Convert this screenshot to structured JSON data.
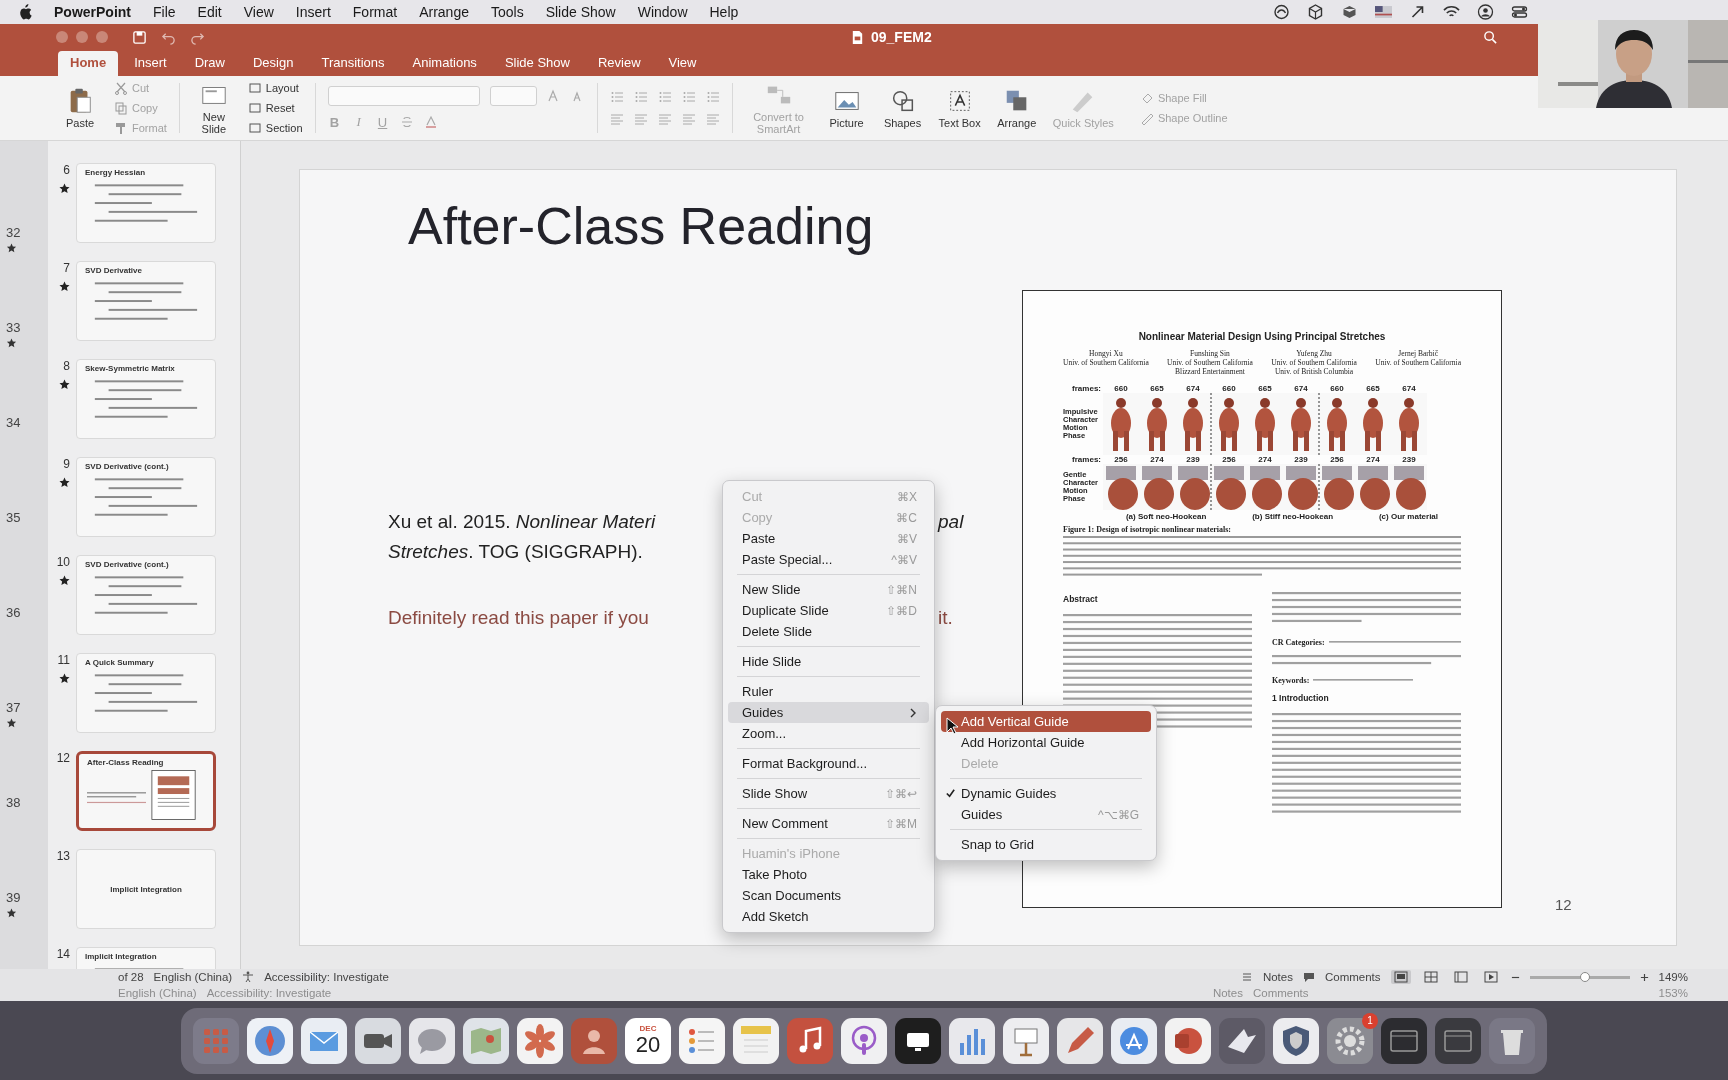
{
  "menu_bar": {
    "app": "PowerPoint",
    "items": [
      "File",
      "Edit",
      "View",
      "Insert",
      "Format",
      "Arrange",
      "Tools",
      "Slide Show",
      "Window",
      "Help"
    ]
  },
  "window": {
    "title": "09_FEM2"
  },
  "tabs": [
    {
      "label": "Home",
      "selected": true
    },
    {
      "label": "Insert",
      "selected": false
    },
    {
      "label": "Draw",
      "selected": false
    },
    {
      "label": "Design",
      "selected": false
    },
    {
      "label": "Transitions",
      "selected": false
    },
    {
      "label": "Animations",
      "selected": false
    },
    {
      "label": "Slide Show",
      "selected": false
    },
    {
      "label": "Review",
      "selected": false
    },
    {
      "label": "View",
      "selected": false
    }
  ],
  "ribbon": {
    "paste": {
      "label": "Paste",
      "disabled": false
    },
    "clipboard": [
      {
        "label": "Cut",
        "disabled": true
      },
      {
        "label": "Copy",
        "disabled": true
      },
      {
        "label": "Format",
        "disabled": true
      }
    ],
    "new_slide": {
      "label": "New Slide",
      "disabled": false
    },
    "slide_tools": [
      {
        "label": "Layout",
        "disabled": false
      },
      {
        "label": "Reset",
        "disabled": false
      },
      {
        "label": "Section",
        "disabled": false
      }
    ],
    "font_buttons": [
      {
        "label": "B",
        "disabled": true
      },
      {
        "label": "I",
        "disabled": true
      },
      {
        "label": "U",
        "disabled": true
      }
    ],
    "insert_tools": [
      {
        "label": "Convert to SmartArt",
        "disabled": true
      },
      {
        "label": "Picture",
        "disabled": false
      },
      {
        "label": "Shapes",
        "disabled": false
      },
      {
        "label": "Text Box",
        "disabled": false
      },
      {
        "label": "Arrange",
        "disabled": false
      },
      {
        "label": "Quick Styles",
        "disabled": true
      }
    ],
    "shape_tools": [
      {
        "label": "Shape Fill",
        "disabled": true
      },
      {
        "label": "Shape Outline",
        "disabled": true
      }
    ]
  },
  "ghost_slide_numbers": [
    {
      "number": "32",
      "starred": true
    },
    {
      "number": "33",
      "starred": true
    },
    {
      "number": "34",
      "starred": false
    },
    {
      "number": "35",
      "starred": false
    },
    {
      "number": "36",
      "starred": false
    },
    {
      "number": "37",
      "starred": true
    },
    {
      "number": "38",
      "starred": false
    },
    {
      "number": "39",
      "starred": true
    }
  ],
  "thumbnails": [
    {
      "number": "6",
      "title": "Energy Hessian",
      "kind": "formulas",
      "starred": true,
      "selected": false
    },
    {
      "number": "7",
      "title": "SVD Derivative",
      "kind": "formulas",
      "starred": true,
      "selected": false
    },
    {
      "number": "8",
      "title": "Skew-Symmetric Matrix",
      "kind": "formulas",
      "starred": true,
      "selected": false
    },
    {
      "number": "9",
      "title": "SVD Derivative (cont.)",
      "kind": "formulas",
      "starred": true,
      "selected": false
    },
    {
      "number": "10",
      "title": "SVD Derivative (cont.)",
      "kind": "formulas",
      "starred": true,
      "selected": false
    },
    {
      "number": "11",
      "title": "A Quick Summary",
      "kind": "formulas",
      "starred": true,
      "selected": false
    },
    {
      "number": "12",
      "title": "After-Class Reading",
      "kind": "reading",
      "starred": false,
      "selected": true
    },
    {
      "number": "13",
      "title": "Implicit Integration",
      "kind": "title_only",
      "starred": false,
      "selected": false
    },
    {
      "number": "14",
      "title": "Implicit Integration",
      "kind": "formulas",
      "starred": false,
      "selected": false
    }
  ],
  "slide": {
    "title": "After-Class Reading",
    "citation_left": "Xu et al. 2015. *Nonlinear Materi*",
    "citation_right": "*pal*",
    "citation_line2": "*Stretches*. TOG (SIGGRAPH).",
    "note_left": "Definitely read this paper if you",
    "note_right": "it.",
    "number": "12",
    "paper": {
      "title": "Nonlinear Material Design Using Principal Stretches",
      "authors": [
        {
          "name": "Hongyi Xu",
          "affiliations": [
            "Univ. of Southern California"
          ]
        },
        {
          "name": "Funshing Sin",
          "affiliations": [
            "Univ. of Southern California",
            "Blizzard Entertainment"
          ]
        },
        {
          "name": "Yufeng Zhu",
          "affiliations": [
            "Univ. of Southern California",
            "Univ. of British Columbia"
          ]
        },
        {
          "name": "Jernej Barbič",
          "affiliations": [
            "Univ. of Southern California"
          ]
        }
      ],
      "figure_rows": [
        {
          "frames_label": "frames:",
          "label": "Impulsive Character Motion Phase",
          "frames": [
            "660",
            "665",
            "674",
            "660",
            "665",
            "674",
            "660",
            "665",
            "674"
          ]
        },
        {
          "frames_label": "frames:",
          "label": "Gentle Character Motion Phase",
          "frames": [
            "256",
            "274",
            "239",
            "256",
            "274",
            "239",
            "256",
            "274",
            "239"
          ]
        }
      ],
      "subcaptions": [
        "(a) Soft neo-Hookean",
        "(b) Stiff neo-Hookean",
        "(c) Our material"
      ],
      "caption_lead": "Figure 1: Design of isotropic nonlinear materials:",
      "abstract_heading": "Abstract",
      "cr_lead": "CR Categories:",
      "keywords_lead": "Keywords:",
      "intro_heading": "1 Introduction"
    }
  },
  "context_menu": [
    {
      "kind": "item",
      "label": "Cut",
      "shortcut": "⌘X",
      "disabled": true,
      "selected": false
    },
    {
      "kind": "item",
      "label": "Copy",
      "shortcut": "⌘C",
      "disabled": true,
      "selected": false
    },
    {
      "kind": "item",
      "label": "Paste",
      "shortcut": "⌘V",
      "disabled": false,
      "selected": false
    },
    {
      "kind": "item",
      "label": "Paste Special...",
      "shortcut": "^⌘V",
      "disabled": false,
      "selected": false
    },
    {
      "kind": "separator"
    },
    {
      "kind": "item",
      "label": "New Slide",
      "shortcut": "⇧⌘N",
      "disabled": false,
      "selected": false
    },
    {
      "kind": "item",
      "label": "Duplicate Slide",
      "shortcut": "⇧⌘D",
      "disabled": false,
      "selected": false
    },
    {
      "kind": "item",
      "label": "Delete Slide",
      "disabled": false,
      "selected": false
    },
    {
      "kind": "separator"
    },
    {
      "kind": "item",
      "label": "Hide Slide",
      "disabled": false,
      "selected": false
    },
    {
      "kind": "separator"
    },
    {
      "kind": "item",
      "label": "Ruler",
      "disabled": false,
      "selected": false
    },
    {
      "kind": "submenu",
      "label": "Guides",
      "disabled": false,
      "selected": true
    },
    {
      "kind": "item",
      "label": "Zoom...",
      "disabled": false,
      "selected": false
    },
    {
      "kind": "separator"
    },
    {
      "kind": "item",
      "label": "Format Background...",
      "disabled": false,
      "selected": false
    },
    {
      "kind": "separator"
    },
    {
      "kind": "item",
      "label": "Slide Show",
      "shortcut": "⇧⌘↩",
      "disabled": false,
      "selected": false
    },
    {
      "kind": "separator"
    },
    {
      "kind": "item",
      "label": "New Comment",
      "shortcut": "⇧⌘M",
      "disabled": false,
      "selected": false
    },
    {
      "kind": "separator"
    },
    {
      "kind": "item",
      "label": "Huamin's iPhone",
      "disabled": true,
      "selected": false
    },
    {
      "kind": "item",
      "label": "Take Photo",
      "disabled": false,
      "selected": false
    },
    {
      "kind": "item",
      "label": "Scan Documents",
      "disabled": false,
      "selected": false
    },
    {
      "kind": "item",
      "label": "Add Sketch",
      "disabled": false,
      "selected": false
    }
  ],
  "guides_submenu": [
    {
      "kind": "item",
      "label": "Add Vertical Guide",
      "disabled": false,
      "selected": true,
      "checked": false
    },
    {
      "kind": "item",
      "label": "Add Horizontal Guide",
      "disabled": false,
      "selected": false,
      "checked": false
    },
    {
      "kind": "item",
      "label": "Delete",
      "disabled": true,
      "selected": false,
      "checked": false
    },
    {
      "kind": "separator"
    },
    {
      "kind": "item",
      "label": "Dynamic Guides",
      "disabled": false,
      "selected": false,
      "checked": true
    },
    {
      "kind": "item",
      "label": "Guides",
      "shortcut": "^⌥⌘G",
      "disabled": false,
      "selected": false,
      "checked": false
    },
    {
      "kind": "separator"
    },
    {
      "kind": "item",
      "label": "Snap to Grid",
      "disabled": false,
      "selected": false,
      "checked": false
    }
  ],
  "status_bar": {
    "slide_count": "of 28",
    "language": "English (China)",
    "accessibility": "Accessibility: Investigate",
    "notes": "Notes",
    "comments": "Comments",
    "zoom": "149%",
    "zoom_slider": {
      "level": 0.55
    },
    "views": [
      {
        "selected": true
      },
      {
        "selected": false
      },
      {
        "selected": false
      },
      {
        "selected": false
      }
    ]
  },
  "status_bar_ghost": {
    "language": "English (China)",
    "accessibility": "Accessibility: Investigate",
    "notes": "Notes",
    "comments": "Comments",
    "zoom": "153%"
  },
  "dock": {
    "calendar_month": "DEC",
    "calendar_day": "20",
    "settings_badge": "1"
  }
}
